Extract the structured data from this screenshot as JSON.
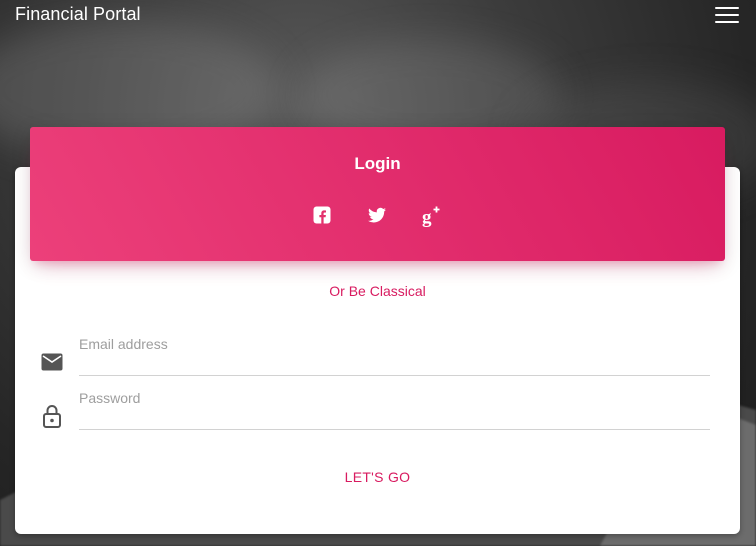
{
  "app": {
    "brand": "Financial Portal",
    "menu_icon": "hamburger-menu-icon"
  },
  "login": {
    "title": "Login",
    "social": [
      {
        "name": "facebook",
        "icon": "facebook-icon"
      },
      {
        "name": "twitter",
        "icon": "twitter-icon"
      },
      {
        "name": "google-plus",
        "icon": "google-plus-icon"
      }
    ],
    "divider_text": "Or Be Classical",
    "email": {
      "label": "Email address",
      "value": "",
      "icon": "email-icon"
    },
    "password": {
      "label": "Password",
      "value": "",
      "icon": "lock-icon"
    },
    "submit_label": "LET'S GO"
  },
  "colors": {
    "accent": "#d81b60",
    "header_gradient_start": "#ec407a",
    "header_gradient_end": "#d81b60",
    "card_background": "#ffffff"
  }
}
